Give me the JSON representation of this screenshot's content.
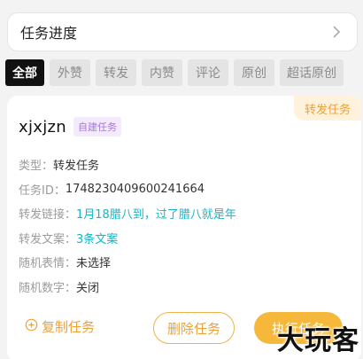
{
  "header": {
    "title": "任务进度"
  },
  "tabs": [
    {
      "label": "全部",
      "active": true
    },
    {
      "label": "外赞",
      "active": false
    },
    {
      "label": "转发",
      "active": false
    },
    {
      "label": "内赞",
      "active": false
    },
    {
      "label": "评论",
      "active": false
    },
    {
      "label": "原创",
      "active": false
    },
    {
      "label": "超话原创",
      "active": false
    }
  ],
  "card": {
    "type_badge": "转发任务",
    "name": "xjxjzn",
    "self_badge": "自建任务",
    "rows": [
      {
        "label": "类型：",
        "value": "转发任务",
        "link": false
      },
      {
        "label": "任务ID：",
        "value": "1748230409600241664",
        "link": false
      },
      {
        "label": "转发链接：",
        "value": "1月18腊八到，过了腊八就是年",
        "link": true
      },
      {
        "label": "转发文案：",
        "value": "3条文案",
        "link": true
      },
      {
        "label": "随机表情：",
        "value": "未选择",
        "link": false
      },
      {
        "label": "随机数字：",
        "value": "关闭",
        "link": false
      }
    ],
    "actions": {
      "copy": "复制任务",
      "delete": "删除任务",
      "execute": "执行任务"
    }
  },
  "watermark": "大玩客",
  "colors": {
    "accent": "#e9a23b",
    "link": "#16b4c9",
    "self_badge": "#a576d8"
  }
}
